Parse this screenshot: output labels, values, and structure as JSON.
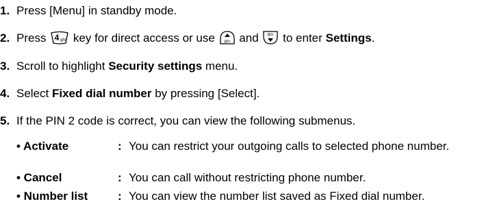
{
  "steps": [
    {
      "num": "1.",
      "parts": {
        "a": "Press [Menu] in standby mode."
      }
    },
    {
      "num": "2.",
      "parts": {
        "a": "Press ",
        "b": " key for direct access or use ",
        "c": " and ",
        "d": " to enter ",
        "e": "Settings",
        "f": "."
      },
      "icons": {
        "key4": "4ghi-key-icon",
        "up": "nav-up-key-icon",
        "down": "nav-down-key-icon"
      }
    },
    {
      "num": "3.",
      "parts": {
        "a": "Scroll to highlight ",
        "b": "Security settings",
        "c": " menu."
      }
    },
    {
      "num": "4.",
      "parts": {
        "a": "Select ",
        "b": "Fixed dial number",
        "c": " by pressing [Select]."
      }
    },
    {
      "num": "5.",
      "parts": {
        "a": "If the PIN 2 code is correct, you can view the following submenus."
      }
    }
  ],
  "submenus": [
    {
      "label": "• Activate",
      "colon": ":",
      "desc": "You can restrict your outgoing calls to selected phone number."
    },
    {
      "label": "• Cancel",
      "colon": ":",
      "desc": "You can call without restricting phone number."
    },
    {
      "label": "• Number list",
      "colon": ":",
      "desc": "You can view the number list saved as Fixed dial number."
    }
  ],
  "key_glyphs": {
    "key4_main": "4",
    "key4_sub": "ghi",
    "nav_sub": "@/c"
  }
}
